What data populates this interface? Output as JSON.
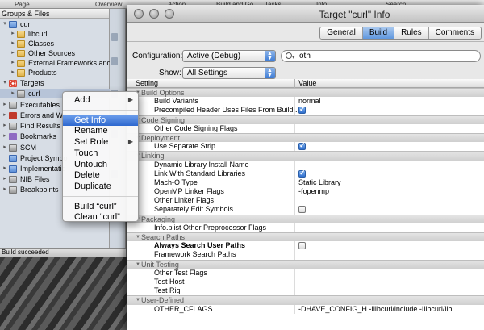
{
  "toolbar": {
    "items": [
      "Page",
      "Overview",
      "Action",
      "Build and Go",
      "Tasks",
      "Info",
      "Search"
    ]
  },
  "groups": {
    "header": "Groups & Files",
    "items": [
      {
        "label": "curl",
        "icon": "blue-project-icon"
      },
      {
        "label": "libcurl",
        "icon": "folder-icon"
      },
      {
        "label": "Classes",
        "icon": "folder-icon"
      },
      {
        "label": "Other Sources",
        "icon": "folder-icon"
      },
      {
        "label": "External Frameworks and",
        "icon": "folder-icon"
      },
      {
        "label": "Products",
        "icon": "folder-icon"
      },
      {
        "label": "Targets",
        "icon": "target-icon"
      },
      {
        "label": "curl",
        "icon": "target-app-icon"
      },
      {
        "label": "Executables",
        "icon": "executable-icon"
      },
      {
        "label": "Errors and Wa",
        "icon": "warning-icon"
      },
      {
        "label": "Find Results",
        "icon": "find-icon"
      },
      {
        "label": "Bookmarks",
        "icon": "bookmark-icon"
      },
      {
        "label": "SCM",
        "icon": "scm-icon"
      },
      {
        "label": "Project Symbo",
        "icon": "symbol-icon"
      },
      {
        "label": "Implementatio",
        "icon": "implementation-icon"
      },
      {
        "label": "NIB Files",
        "icon": "nib-icon"
      },
      {
        "label": "Breakpoints",
        "icon": "breakpoint-icon"
      }
    ]
  },
  "status_bar": {
    "text": "Build succeeded"
  },
  "info_window": {
    "title": "Target \"curl\" Info",
    "tabs": [
      {
        "label": "General",
        "active": false
      },
      {
        "label": "Build",
        "active": true
      },
      {
        "label": "Rules",
        "active": false
      },
      {
        "label": "Comments",
        "active": false
      }
    ],
    "configuration_label": "Configuration:",
    "configuration_value": "Active (Debug)",
    "show_label": "Show:",
    "show_value": "All Settings",
    "search_value": "oth",
    "columns": {
      "setting": "Setting",
      "value": "Value"
    },
    "rows": [
      {
        "type": "cat",
        "label": "Build Options"
      },
      {
        "type": "row",
        "name": "Build Variants",
        "value": "normal"
      },
      {
        "type": "row",
        "name": "Precompiled Header Uses Files From Build...",
        "check": true
      },
      {
        "type": "cat",
        "label": "Code Signing"
      },
      {
        "type": "row",
        "name": "Other Code Signing Flags",
        "value": ""
      },
      {
        "type": "cat",
        "label": "Deployment"
      },
      {
        "type": "row",
        "name": "Use Separate Strip",
        "check": true
      },
      {
        "type": "cat",
        "label": "Linking"
      },
      {
        "type": "row",
        "name": "Dynamic Library Install Name",
        "value": ""
      },
      {
        "type": "row",
        "name": "Link With Standard Libraries",
        "check": true
      },
      {
        "type": "row",
        "name": "Mach-O Type",
        "value": "Static Library"
      },
      {
        "type": "row",
        "name": "OpenMP Linker Flags",
        "value": "-fopenmp"
      },
      {
        "type": "row",
        "name": "Other Linker Flags",
        "value": ""
      },
      {
        "type": "row",
        "name": "Separately Edit Symbols",
        "check": false
      },
      {
        "type": "cat",
        "label": "Packaging"
      },
      {
        "type": "row",
        "name": "Info.plist Other Preprocessor Flags",
        "value": ""
      },
      {
        "type": "cat",
        "label": "Search Paths"
      },
      {
        "type": "row",
        "name": "Always Search User Paths",
        "check": false,
        "bold": true
      },
      {
        "type": "row",
        "name": "Framework Search Paths",
        "value": ""
      },
      {
        "type": "cat",
        "label": "Unit Testing"
      },
      {
        "type": "row",
        "name": "Other Test Flags",
        "value": ""
      },
      {
        "type": "row",
        "name": "Test Host",
        "value": ""
      },
      {
        "type": "row",
        "name": "Test Rig",
        "value": ""
      },
      {
        "type": "cat",
        "label": "User-Defined"
      },
      {
        "type": "row",
        "name": "OTHER_CFLAGS",
        "value": "-DHAVE_CONFIG_H -Ilibcurl/include -Ilibcurl/lib"
      }
    ]
  },
  "context_menu": {
    "items": [
      {
        "label": "Add",
        "submenu": true
      },
      {
        "sep": true
      },
      {
        "label": "Get Info",
        "highlighted": true
      },
      {
        "label": "Rename"
      },
      {
        "label": "Set Role",
        "submenu": true
      },
      {
        "label": "Touch"
      },
      {
        "label": "Untouch"
      },
      {
        "label": "Delete"
      },
      {
        "label": "Duplicate"
      },
      {
        "sep": true
      },
      {
        "label": "Build “curl”"
      },
      {
        "label": "Clean “curl”"
      }
    ]
  },
  "colors": {
    "highlight": "#3a73d6",
    "sidebar": "#d7dde5",
    "checkbox_on": "#2f6fcf"
  }
}
